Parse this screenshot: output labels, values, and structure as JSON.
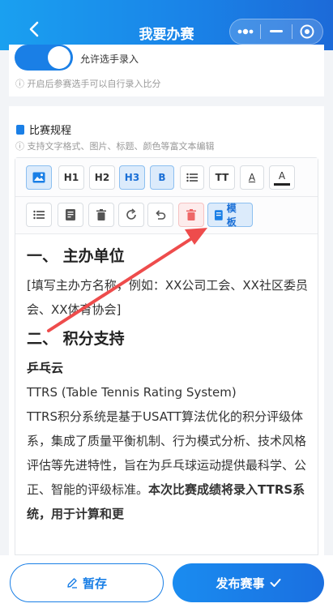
{
  "header": {
    "title": "我要办赛"
  },
  "settings": {
    "allow_self_entry_label": "允许选手录入",
    "allow_self_entry_on": true,
    "allow_self_entry_hint": "ⓘ 开启后参赛选手可以自行录入比分"
  },
  "rules": {
    "title": "比赛规程",
    "hint": "ⓘ 支持文字格式、图片、标题、颜色等富文本编辑"
  },
  "toolbar": {
    "h1": "H1",
    "h2": "H2",
    "h3": "H3",
    "bold": "B",
    "tt": "TT",
    "text_color": "A",
    "bg_color": "A",
    "template": "模板"
  },
  "content": {
    "h_organizer": "一、 主办单位",
    "organizer_text": "[填写主办方名称，例如：XX公司工会、XX社区委员会、XX体育协会]",
    "h_points": "二、 积分支持",
    "pingpong_cloud": "乒乓云",
    "ttrs": "TTRS (Table Tennis Rating System)",
    "ttrs_desc": "TTRS积分系统是基于USATT算法优化的积分评级体系，集成了质量平衡机制、行为模式分析、技术风格评估等先进特性，旨在为乒乓球运动提供最科学、公正、智能的评级标准。",
    "ttrs_bold": "本次比赛成绩将录入TTRS系统，用于计算和更"
  },
  "footer": {
    "save": "暂存",
    "publish": "发布赛事"
  },
  "colors": {
    "primary": "#1a7fe6",
    "annotation_arrow": "#ee4c4c"
  }
}
